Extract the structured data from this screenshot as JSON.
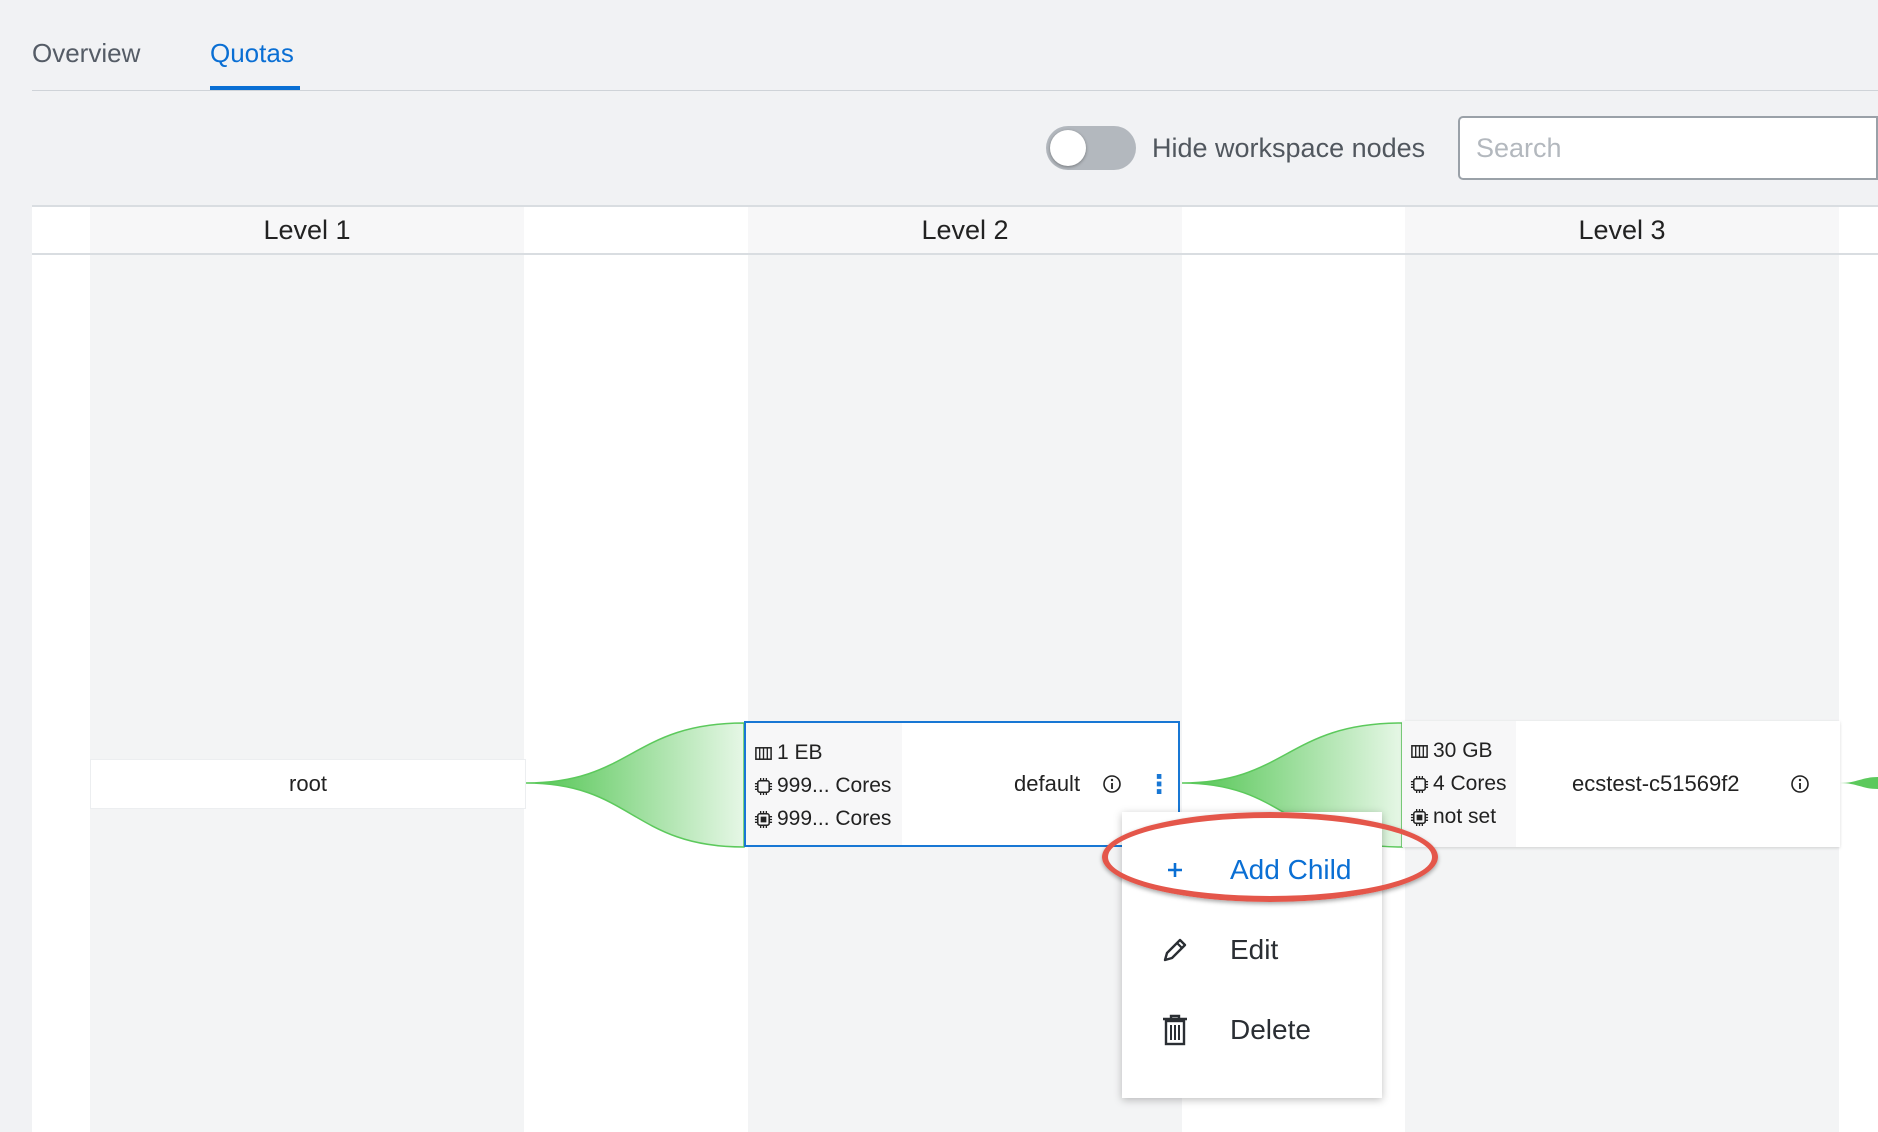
{
  "tabs": [
    {
      "label": "Overview",
      "active": false
    },
    {
      "label": "Quotas",
      "active": true
    }
  ],
  "toolbar": {
    "toggle_label": "Hide workspace nodes",
    "toggle_on": false,
    "search_placeholder": "Search",
    "search_value": ""
  },
  "levels": [
    "Level 1",
    "Level 2",
    "Level 3"
  ],
  "nodes": {
    "root": {
      "name": "root"
    },
    "default": {
      "name": "default",
      "memory": "1 EB",
      "cpu": "999... Cores",
      "gpu": "999... Cores"
    },
    "ecstest": {
      "name": "ecstest-c51569f2",
      "memory": "30 GB",
      "cpu": "4 Cores",
      "gpu": "not set"
    }
  },
  "menu": {
    "items": [
      {
        "label": "Add Child",
        "icon": "plus-icon",
        "highlighted": true
      },
      {
        "label": "Edit",
        "icon": "pencil-icon"
      },
      {
        "label": "Delete",
        "icon": "trash-icon"
      }
    ]
  },
  "colors": {
    "accent": "#0a6fd4",
    "flow": "#5cc95c",
    "highlight": "#e4564a"
  }
}
